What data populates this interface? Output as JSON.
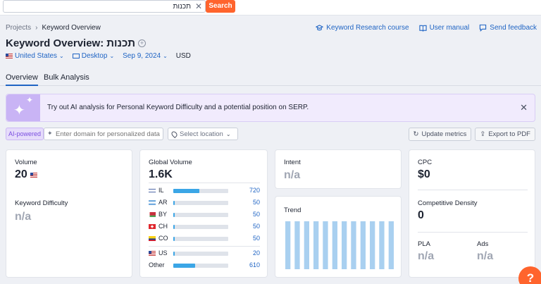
{
  "search": {
    "value": "תכנות",
    "button": "Search"
  },
  "breadcrumb": {
    "projects": "Projects",
    "current": "Keyword Overview"
  },
  "header_links": {
    "research_course": "Keyword Research course",
    "user_manual": "User manual",
    "feedback": "Send feedback"
  },
  "page_title": "Keyword Overview:",
  "keyword": "תכנות",
  "filters": {
    "country": "United States",
    "device": "Desktop",
    "date": "Sep 9, 2024",
    "currency": "USD"
  },
  "tabs": [
    "Overview",
    "Bulk Analysis"
  ],
  "banner": {
    "prefix": "Try out",
    "highlight": "AI analysis",
    "rest": "for Personal Keyword Difficulty and a potential position on SERP."
  },
  "ai": {
    "badge": "AI-powered",
    "domain_placeholder": "Enter domain for personalized data",
    "location_placeholder": "Select location"
  },
  "actions": {
    "update": "Update metrics",
    "export": "Export to PDF"
  },
  "volume": {
    "label": "Volume",
    "value": "20"
  },
  "keyword_difficulty": {
    "label": "Keyword Difficulty",
    "value": "n/a"
  },
  "global_volume": {
    "label": "Global Volume",
    "value": "1.6K",
    "rows": [
      {
        "code": "IL",
        "value": "720",
        "fraction": 0.47
      },
      {
        "code": "AR",
        "value": "50",
        "fraction": 0.03
      },
      {
        "code": "BY",
        "value": "50",
        "fraction": 0.03
      },
      {
        "code": "CH",
        "value": "50",
        "fraction": 0.03
      },
      {
        "code": "CO",
        "value": "50",
        "fraction": 0.03
      },
      {
        "code": "US",
        "value": "20",
        "fraction": 0.02
      },
      {
        "code": "Other",
        "value": "610",
        "fraction": 0.4
      }
    ]
  },
  "intent": {
    "label": "Intent",
    "value": "n/a"
  },
  "trend": {
    "label": "Trend",
    "values": [
      1,
      1,
      1,
      1,
      1,
      1,
      1,
      1,
      1,
      1,
      1,
      1
    ]
  },
  "cpc": {
    "label": "CPC",
    "value": "$0"
  },
  "competitive_density": {
    "label": "Competitive Density",
    "value": "0"
  },
  "pla": {
    "label": "PLA",
    "value": "n/a"
  },
  "ads": {
    "label": "Ads",
    "value": "n/a"
  },
  "help": "?",
  "colors": {
    "accent": "#ff642d",
    "link": "#1f64c4",
    "bar": "#3ba6e6",
    "trend_bar": "#a9d0f0",
    "ai_purple": "#7a4ee0"
  }
}
